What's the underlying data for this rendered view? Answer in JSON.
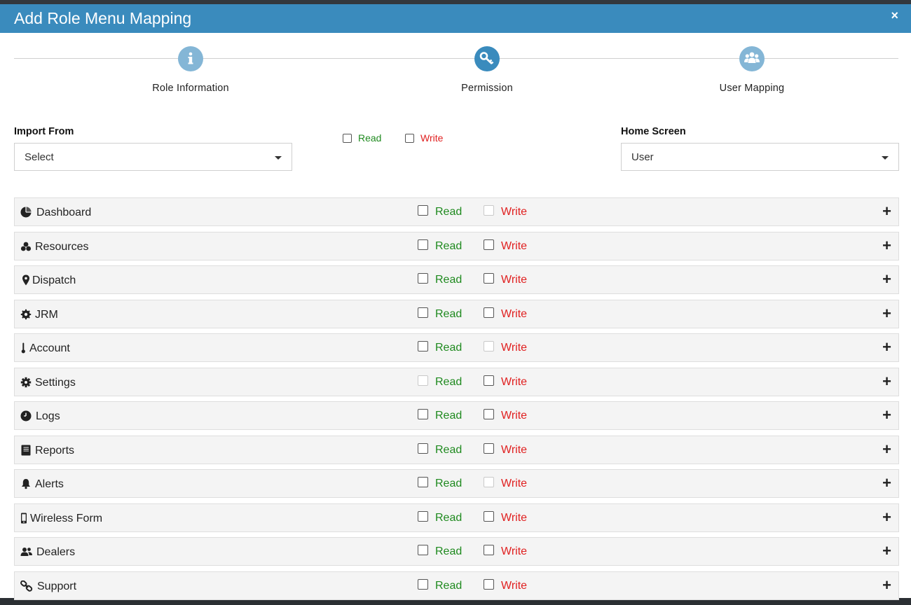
{
  "modal": {
    "title": "Add Role Menu Mapping",
    "close_glyph": "×"
  },
  "stepper": {
    "steps": [
      {
        "label": "Role Information",
        "icon": "info-icon"
      },
      {
        "label": "Permission",
        "icon": "key-icon"
      },
      {
        "label": "User Mapping",
        "icon": "users-icon"
      }
    ]
  },
  "form": {
    "import_from": {
      "label": "Import From",
      "value": "Select"
    },
    "global_read_label": "Read",
    "global_write_label": "Write",
    "home_screen": {
      "label": "Home Screen",
      "value": "User"
    }
  },
  "menus": [
    {
      "name": "Dashboard",
      "icon": "pie-chart-icon",
      "read": "Read",
      "write": "Write",
      "read_disabled": false,
      "write_disabled": true
    },
    {
      "name": "Resources",
      "icon": "cubes-icon",
      "read": "Read",
      "write": "Write",
      "read_disabled": false,
      "write_disabled": false
    },
    {
      "name": "Dispatch",
      "icon": "map-marker-icon",
      "read": "Read",
      "write": "Write",
      "read_disabled": false,
      "write_disabled": false
    },
    {
      "name": "JRM",
      "icon": "gear-badge-icon",
      "read": "Read",
      "write": "Write",
      "read_disabled": false,
      "write_disabled": false
    },
    {
      "name": "Account",
      "icon": "thermometer-icon",
      "read": "Read",
      "write": "Write",
      "read_disabled": false,
      "write_disabled": true
    },
    {
      "name": "Settings",
      "icon": "cog-icon",
      "read": "Read",
      "write": "Write",
      "read_disabled": true,
      "write_disabled": false
    },
    {
      "name": "Logs",
      "icon": "clock-icon",
      "read": "Read",
      "write": "Write",
      "read_disabled": false,
      "write_disabled": false
    },
    {
      "name": "Reports",
      "icon": "book-icon",
      "read": "Read",
      "write": "Write",
      "read_disabled": false,
      "write_disabled": false
    },
    {
      "name": "Alerts",
      "icon": "bell-icon",
      "read": "Read",
      "write": "Write",
      "read_disabled": false,
      "write_disabled": true
    },
    {
      "name": "Wireless Form",
      "icon": "mobile-icon",
      "read": "Read",
      "write": "Write",
      "read_disabled": false,
      "write_disabled": false
    },
    {
      "name": "Dealers",
      "icon": "user-group-icon",
      "read": "Read",
      "write": "Write",
      "read_disabled": false,
      "write_disabled": false
    },
    {
      "name": "Support",
      "icon": "link-icon",
      "read": "Read",
      "write": "Write",
      "read_disabled": false,
      "write_disabled": false
    }
  ],
  "expand_glyph": "+"
}
